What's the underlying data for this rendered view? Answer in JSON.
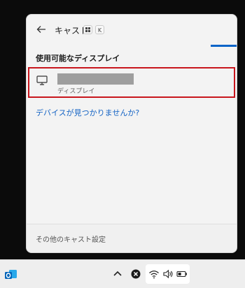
{
  "flyout": {
    "title": "キャスト",
    "shortcut": {
      "win_icon": "windows-logo-icon",
      "key": "K"
    },
    "section_title": "使用可能なディスプレイ",
    "devices": [
      {
        "name": "",
        "type": "ディスプレイ",
        "icon": "monitor-icon",
        "selected": true
      }
    ],
    "help_link": "デバイスが見つかりませんか?",
    "footer_link": "その他のキャスト設定"
  },
  "taskbar": {
    "tray_icons": [
      "chevron-up-icon",
      "close-circle-icon",
      "wifi-icon",
      "speaker-icon",
      "battery-icon"
    ],
    "pinned": [
      "outlook-icon"
    ]
  },
  "colors": {
    "accent": "#0a64c8",
    "highlight_border": "#c8161d",
    "link": "#1463c4"
  }
}
